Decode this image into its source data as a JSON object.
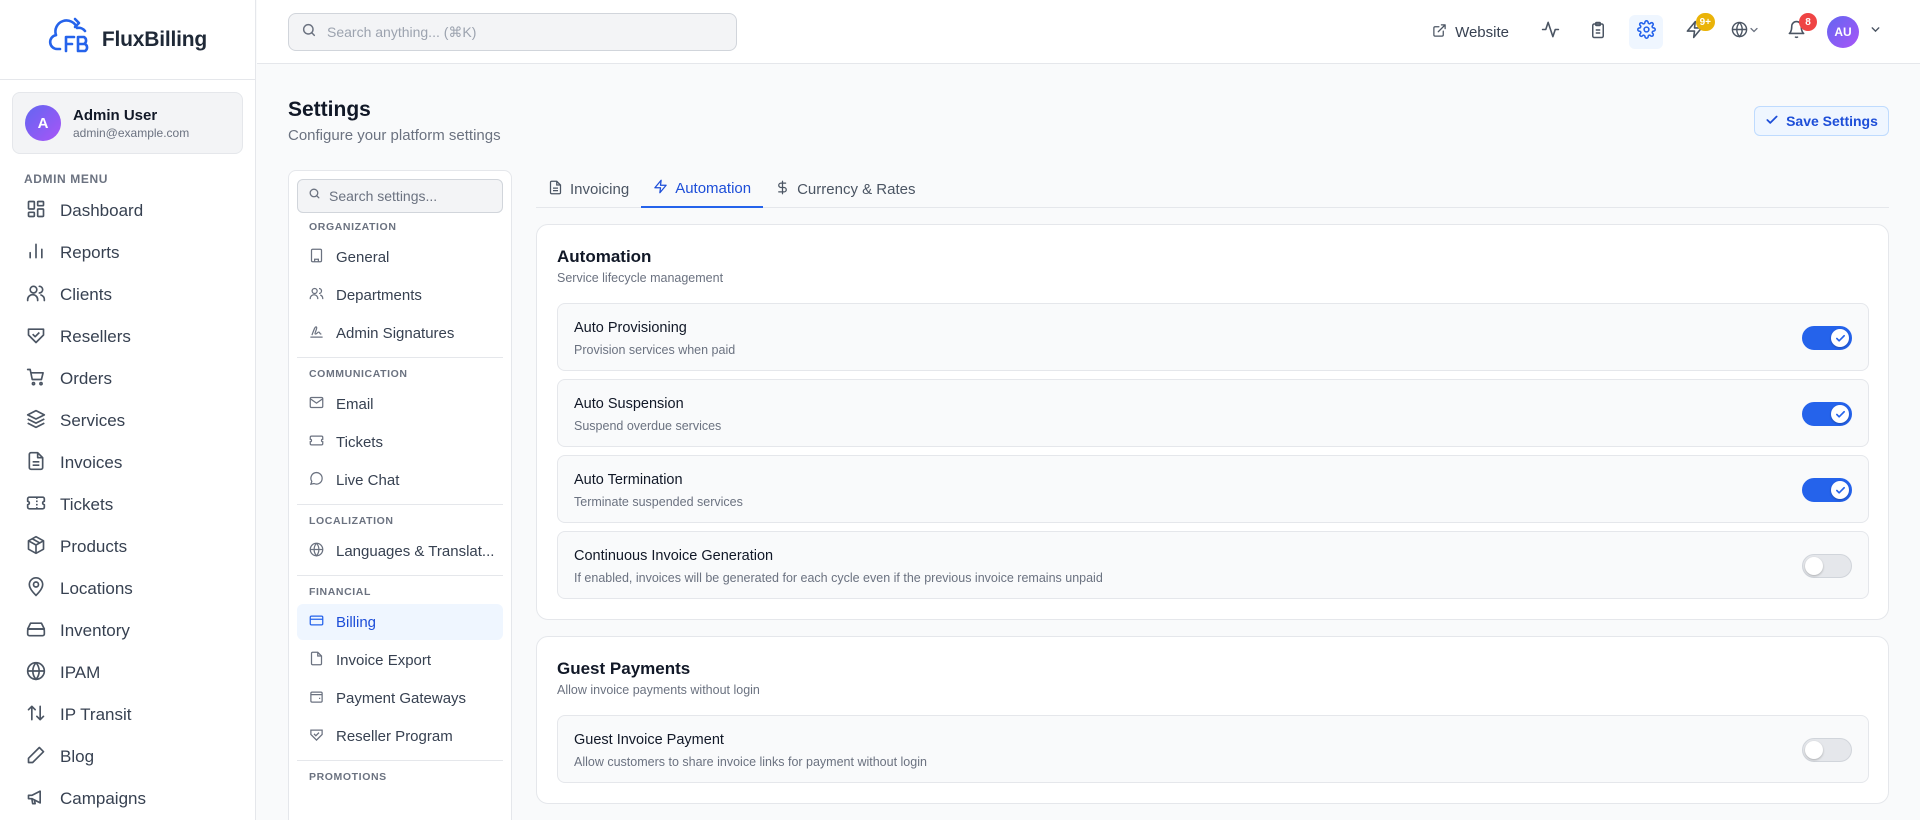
{
  "brand": {
    "name": "FluxBilling"
  },
  "user": {
    "initial": "A",
    "name": "Admin User",
    "email": "admin@example.com"
  },
  "sidebar": {
    "menu_label": "ADMIN MENU",
    "items": [
      {
        "label": "Dashboard",
        "icon": "dashboard-icon"
      },
      {
        "label": "Reports",
        "icon": "bar-chart-icon"
      },
      {
        "label": "Clients",
        "icon": "users-icon"
      },
      {
        "label": "Resellers",
        "icon": "handshake-icon"
      },
      {
        "label": "Orders",
        "icon": "cart-icon"
      },
      {
        "label": "Services",
        "icon": "layers-icon"
      },
      {
        "label": "Invoices",
        "icon": "file-icon"
      },
      {
        "label": "Tickets",
        "icon": "ticket-icon"
      },
      {
        "label": "Products",
        "icon": "package-icon"
      },
      {
        "label": "Locations",
        "icon": "map-pin-icon"
      },
      {
        "label": "Inventory",
        "icon": "hard-drive-icon"
      },
      {
        "label": "IPAM",
        "icon": "globe-icon"
      },
      {
        "label": "IP Transit",
        "icon": "arrows-up-down-icon"
      },
      {
        "label": "Blog",
        "icon": "pen-icon"
      },
      {
        "label": "Campaigns",
        "icon": "megaphone-icon"
      }
    ]
  },
  "topbar": {
    "search_placeholder": "Search anything... (⌘K)",
    "website_label": "Website",
    "badge_quick": "9+",
    "badge_notifications": "8",
    "avatar_initials": "AU"
  },
  "page": {
    "title": "Settings",
    "subtitle": "Configure your platform settings",
    "save_label": "Save Settings"
  },
  "settings_nav": {
    "search_placeholder": "Search settings...",
    "groups": [
      {
        "label": "ORGANIZATION",
        "items": [
          "General",
          "Departments",
          "Admin Signatures"
        ]
      },
      {
        "label": "COMMUNICATION",
        "items": [
          "Email",
          "Tickets",
          "Live Chat"
        ]
      },
      {
        "label": "LOCALIZATION",
        "items": [
          "Languages & Translat..."
        ]
      },
      {
        "label": "FINANCIAL",
        "items": [
          "Billing",
          "Invoice Export",
          "Payment Gateways",
          "Reseller Program"
        ]
      },
      {
        "label": "PROMOTIONS",
        "items": []
      }
    ],
    "active_item": "Billing"
  },
  "tabs": [
    {
      "label": "Invoicing",
      "active": false
    },
    {
      "label": "Automation",
      "active": true
    },
    {
      "label": "Currency & Rates",
      "active": false
    }
  ],
  "automation": {
    "title": "Automation",
    "subtitle": "Service lifecycle management",
    "settings": [
      {
        "title": "Auto Provisioning",
        "description": "Provision services when paid",
        "enabled": true
      },
      {
        "title": "Auto Suspension",
        "description": "Suspend overdue services",
        "enabled": true
      },
      {
        "title": "Auto Termination",
        "description": "Terminate suspended services",
        "enabled": true
      },
      {
        "title": "Continuous Invoice Generation",
        "description": "If enabled, invoices will be generated for each cycle even if the previous invoice remains unpaid",
        "enabled": false
      }
    ]
  },
  "guest_payments": {
    "title": "Guest Payments",
    "subtitle": "Allow invoice payments without login",
    "settings": [
      {
        "title": "Guest Invoice Payment",
        "description": "Allow customers to share invoice links for payment without login",
        "enabled": false
      }
    ]
  },
  "colors": {
    "accent": "#2563eb",
    "accent_text": "#1d4ed8",
    "badge_yellow": "#eab308",
    "badge_red": "#ef4444"
  }
}
